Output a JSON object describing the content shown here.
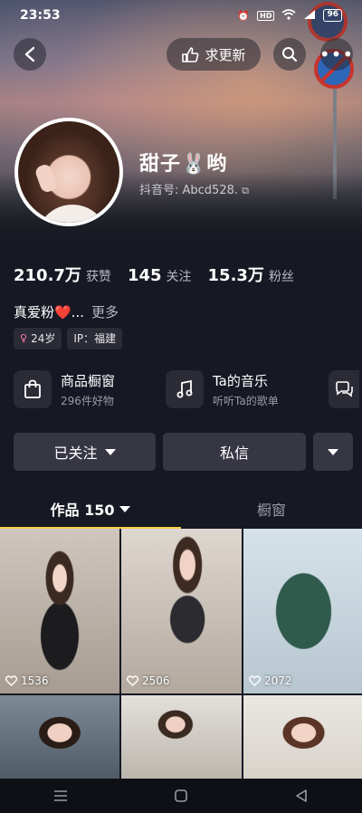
{
  "status": {
    "time": "23:53",
    "battery": "96"
  },
  "top": {
    "update_label": "求更新"
  },
  "profile": {
    "name": "甜子🐰哟",
    "handle": "抖音号: Abcd528."
  },
  "stats": [
    {
      "num": "210.7万",
      "label": "获赞"
    },
    {
      "num": "145",
      "label": "关注"
    },
    {
      "num": "15.3万",
      "label": "粉丝"
    }
  ],
  "bio": {
    "text": "真爱粉❤️...",
    "more": "更多"
  },
  "tags": {
    "age": "24岁",
    "ip": "IP：福建"
  },
  "cards": {
    "shop": {
      "title": "商品橱窗",
      "sub": "296件好物"
    },
    "music": {
      "title": "Ta的音乐",
      "sub": "听听Ta的歌单"
    }
  },
  "actions": {
    "follow": "已关注",
    "message": "私信"
  },
  "tabs": {
    "works": "作品 150",
    "showcase": "橱窗"
  },
  "grid": [
    {
      "likes": "1536"
    },
    {
      "likes": "2506"
    },
    {
      "likes": "2072"
    }
  ],
  "colors": {
    "accent": "#f4cf47",
    "bg": "#161823",
    "button": "#363743"
  }
}
